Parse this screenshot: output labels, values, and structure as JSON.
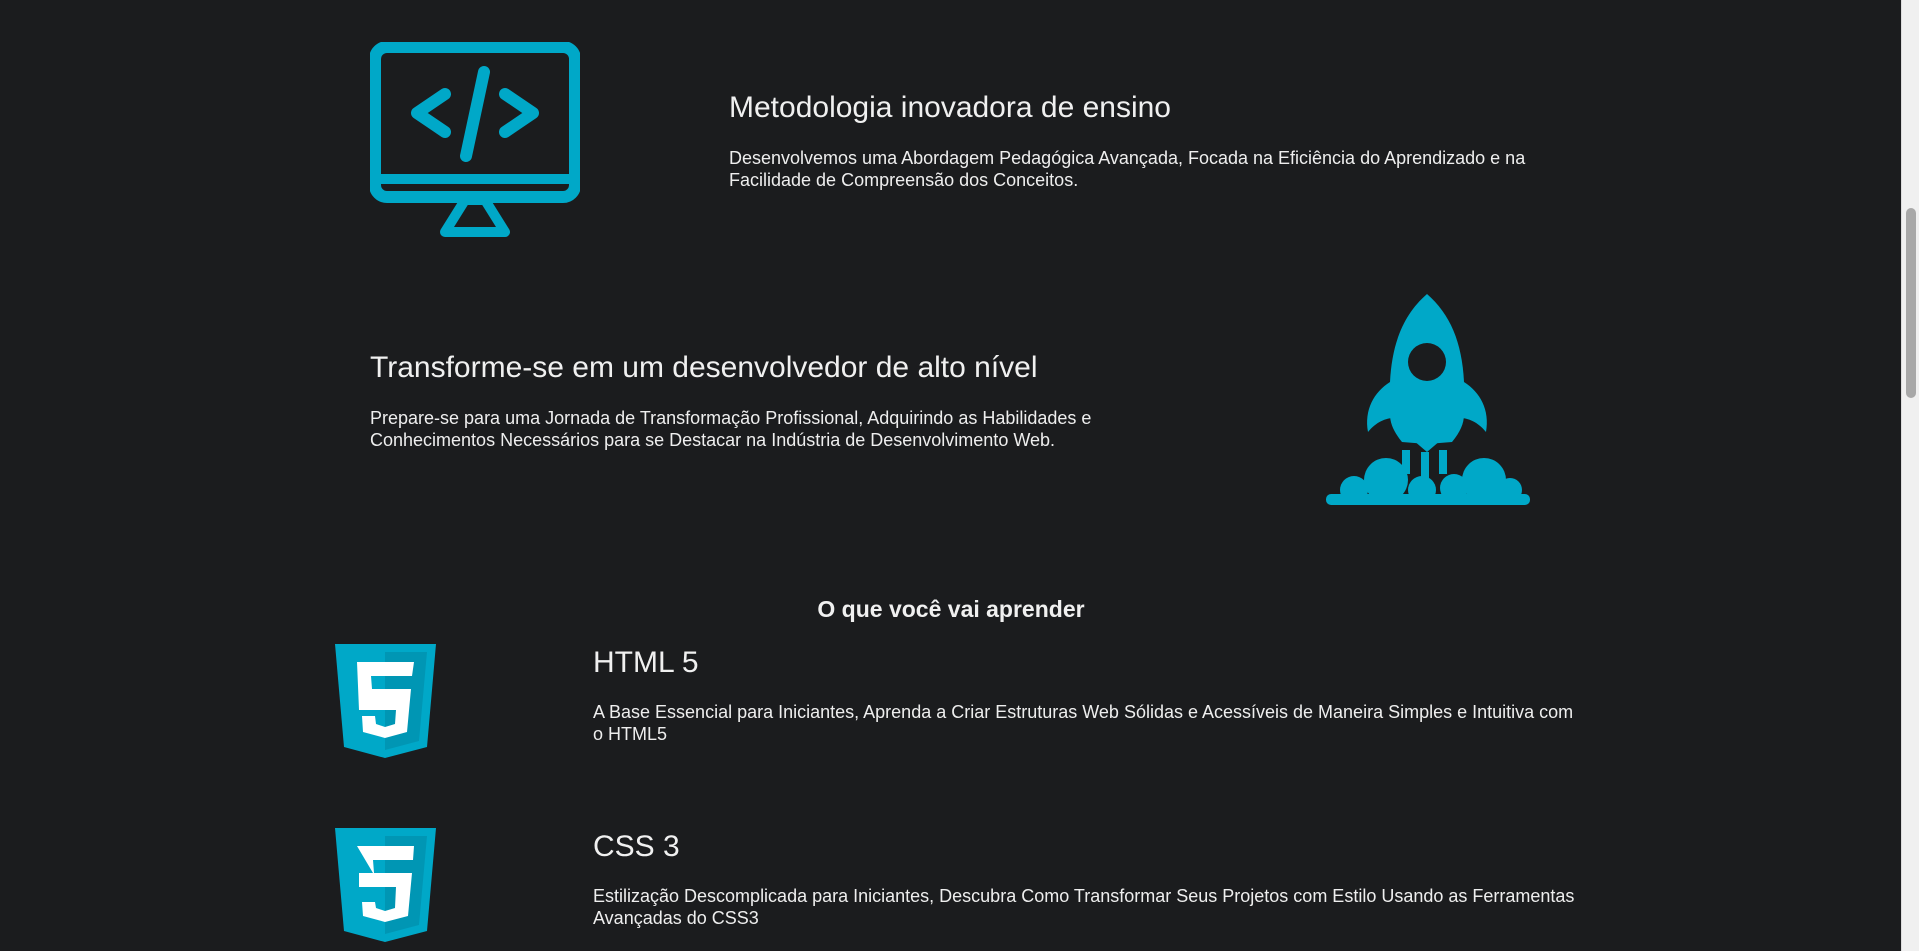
{
  "colors": {
    "background": "#1b1c1e",
    "accent": "#00a8c8",
    "text": "#eeeeee"
  },
  "features": [
    {
      "icon": "code-monitor-icon",
      "title": "Metodologia inovadora de ensino",
      "description": "Desenvolvemos uma Abordagem Pedagógica Avançada, Focada na Eficiência do Aprendizado e na Facilidade de Compreensão dos Conceitos."
    },
    {
      "icon": "rocket-launch-icon",
      "title": "Transforme-se em um desenvolvedor de alto nível",
      "description": "Prepare-se para uma Jornada de Transformação Profissional, Adquirindo as Habilidades e Conhecimentos Necessários para se Destacar na Indústria de Desenvolvimento Web."
    }
  ],
  "learn": {
    "heading": "O que você vai aprender",
    "items": [
      {
        "icon": "html5-icon",
        "title": "HTML 5",
        "description": "A Base Essencial para Iniciantes, Aprenda a Criar Estruturas Web Sólidas e Acessíveis de Maneira Simples e Intuitiva com o HTML5"
      },
      {
        "icon": "css3-icon",
        "title": "CSS 3",
        "description": "Estilização Descomplicada para Iniciantes, Descubra Como Transformar Seus Projetos com Estilo Usando as Ferramentas Avançadas do CSS3"
      }
    ]
  }
}
